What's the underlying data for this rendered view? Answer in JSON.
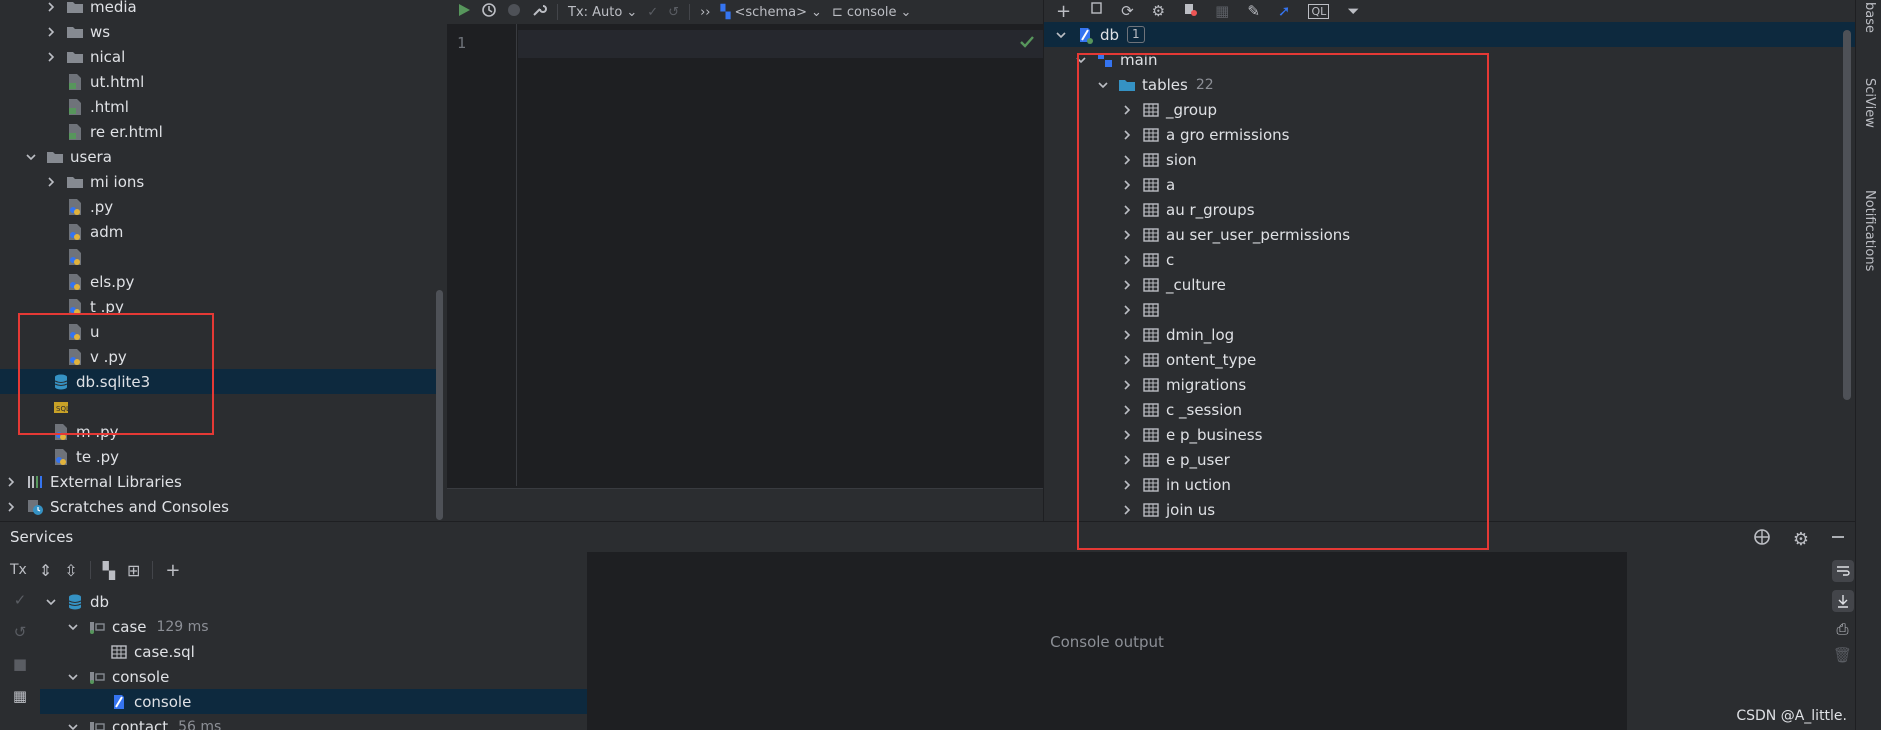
{
  "project_tree": {
    "items": [
      {
        "label": "media",
        "icon": "folder-icon",
        "expand": "collapsed"
      },
      {
        "label": "ws",
        "icon": "folder-icon",
        "expand": "collapsed"
      },
      {
        "label": "nical",
        "icon": "folder-icon",
        "expand": "collapsed"
      },
      {
        "label": "ut.html",
        "icon": "html-file-icon",
        "expand": "none"
      },
      {
        "label": ".html",
        "icon": "html-file-icon",
        "expand": "none"
      },
      {
        "label": "re    er.html",
        "icon": "html-file-icon",
        "expand": "none"
      },
      {
        "label": "usera",
        "icon": "folder-icon",
        "expand": "expanded"
      },
      {
        "label": "mi    ions",
        "icon": "folder-icon",
        "expand": "collapsed"
      },
      {
        "label": ".py",
        "icon": "python-file-icon",
        "expand": "none"
      },
      {
        "label": "adm",
        "icon": "python-file-icon",
        "expand": "none"
      },
      {
        "label": "",
        "icon": "python-file-icon",
        "expand": "none"
      },
      {
        "label": "els.py",
        "icon": "python-file-icon",
        "expand": "none"
      },
      {
        "label": "t .py",
        "icon": "python-file-icon",
        "expand": "none"
      },
      {
        "label": "u",
        "icon": "python-file-icon",
        "expand": "none"
      },
      {
        "label": "v    .py",
        "icon": "python-file-icon",
        "expand": "none"
      },
      {
        "label": "db.sqlite3",
        "icon": "database-icon",
        "expand": "none",
        "selected": true
      },
      {
        "label": "",
        "icon": "sql-file-icon",
        "expand": "none"
      },
      {
        "label": "m    .py",
        "icon": "python-file-icon",
        "expand": "none"
      },
      {
        "label": "te  .py",
        "icon": "python-file-icon",
        "expand": "none"
      },
      {
        "label": "External Libraries",
        "icon": "libraries-icon",
        "expand": "collapsed"
      },
      {
        "label": "Scratches and Consoles",
        "icon": "scratches-icon",
        "expand": "collapsed"
      }
    ]
  },
  "editor": {
    "toolbar": {
      "tx_mode": "Tx: Auto",
      "schema": "<schema>",
      "session": "console",
      "more": "››"
    },
    "line_number": "1"
  },
  "db_panel": {
    "root": {
      "label": "db",
      "badge": "1"
    },
    "schema": {
      "label": "main"
    },
    "tables_folder": {
      "label": "tables",
      "count": "22"
    },
    "tables": [
      "_group",
      "a    gro     ermissions",
      "sion",
      "a",
      "au      r_groups",
      "au    ser_user_permissions",
      "c",
      "_culture",
      "",
      "dmin_log",
      "ontent_type",
      "migrations",
      "c    _session",
      "e    p_business",
      "e    p_user",
      "in      uction",
      "join  us"
    ]
  },
  "right_strip": {
    "top": "base",
    "mid": "SciView",
    "bottom": "Notifications"
  },
  "services": {
    "title": "Services",
    "tx": "Tx",
    "tree": [
      {
        "label": "db",
        "icon": "database-icon",
        "expand": "expanded",
        "indent": 0
      },
      {
        "label": "case",
        "icon": "session-icon",
        "expand": "expanded",
        "indent": 1,
        "ms": "129 ms"
      },
      {
        "label": "case.sql",
        "icon": "table-icon",
        "expand": "none",
        "indent": 2
      },
      {
        "label": "console",
        "icon": "session-icon",
        "expand": "expanded",
        "indent": 1
      },
      {
        "label": "console",
        "icon": "console-icon",
        "expand": "none",
        "indent": 2,
        "selected": true
      },
      {
        "label": "contact",
        "icon": "session-icon",
        "expand": "expanded",
        "indent": 1,
        "ms": "56 ms"
      }
    ],
    "console_output": "Console output",
    "watermark": "CSDN @A_little."
  },
  "colors": {
    "accent": "#3574f0",
    "selection": "#0d293e",
    "highlight_box": "#e53935",
    "run_green": "#57965c"
  }
}
